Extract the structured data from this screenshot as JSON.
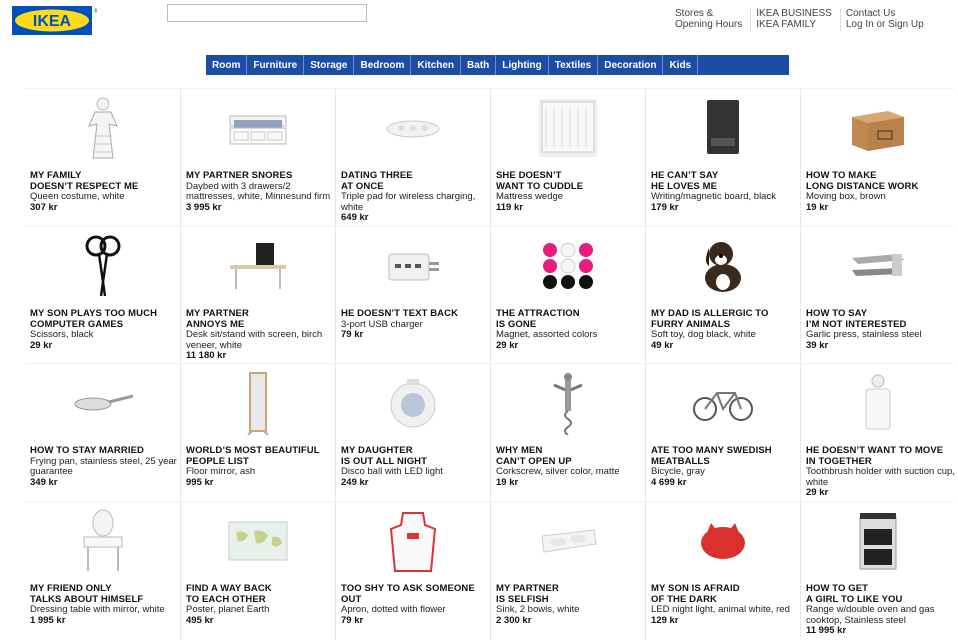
{
  "brand": {
    "logo_text": "IKEA",
    "registered": "®",
    "blue": "#0051ba",
    "yellow": "#ffda1a"
  },
  "search": {
    "placeholder": "",
    "value": ""
  },
  "top_links": [
    [
      "Stores &",
      "Opening Hours"
    ],
    [
      "IKEA BUSINESS",
      "IKEA FAMILY"
    ],
    [
      "Contact Us",
      "Log In or Sign Up"
    ]
  ],
  "nav": [
    "Room",
    "Furniture",
    "Storage",
    "Bedroom",
    "Kitchen",
    "Bath",
    "Lighting",
    "Textiles",
    "Decoration",
    "Kids"
  ],
  "products": [
    {
      "title": "My family\ndoesn’t respect me",
      "desc": "Queen costume, white",
      "price": "307 kr",
      "icon": "costume-icon"
    },
    {
      "title": "My partner snores",
      "desc": "Daybed with 3 drawers/2 mattresses, white, Minnesund firm",
      "price": "3 995 kr",
      "icon": "daybed-icon"
    },
    {
      "title": "Dating three\nat once",
      "desc": "Triple pad for wireless charging, white",
      "price": "649 kr",
      "icon": "charging-pad-icon"
    },
    {
      "title": "She doesn’t\nwant to cuddle",
      "desc": "Mattress wedge",
      "price": "119 kr",
      "icon": "mattress-wedge-icon"
    },
    {
      "title": "He can’t say\nhe loves me",
      "desc": "Writing/magnetic board, black",
      "price": "179 kr",
      "icon": "board-icon"
    },
    {
      "title": "How to make\nlong distance work",
      "desc": "Moving box, brown",
      "price": "19 kr",
      "icon": "moving-box-icon"
    },
    {
      "title": "My son plays too much\ncomputer games",
      "desc": "Scissors, black",
      "price": "29 kr",
      "icon": "scissors-icon"
    },
    {
      "title": "My partner\nannoys me",
      "desc": "Desk sit/stand with screen, birch veneer, white",
      "price": "11 180 kr",
      "icon": "desk-icon"
    },
    {
      "title": "He doesn’t text back",
      "desc": "3-port USB charger",
      "price": "79 kr",
      "icon": "usb-charger-icon"
    },
    {
      "title": "The attraction\nis gone",
      "desc": "Magnet, assorted colors",
      "price": "29 kr",
      "icon": "magnets-icon"
    },
    {
      "title": "My dad is allergic to\nfurry animals",
      "desc": "Soft toy, dog black, white",
      "price": "49 kr",
      "icon": "soft-toy-dog-icon"
    },
    {
      "title": "How to say\nI’m not interested",
      "desc": "Garlic press, stainless steel",
      "price": "39 kr",
      "icon": "garlic-press-icon"
    },
    {
      "title": "How to stay married",
      "desc": "Frying pan, stainless steel, 25 year guarantee",
      "price": "349 kr",
      "icon": "frying-pan-icon"
    },
    {
      "title": "World’s most beautiful\npeople list",
      "desc": "Floor mirror, ash",
      "price": "995 kr",
      "icon": "floor-mirror-icon"
    },
    {
      "title": "My daughter\nis out all night",
      "desc": "Disco ball with LED light",
      "price": "249 kr",
      "icon": "disco-ball-icon"
    },
    {
      "title": "Why men\ncan’t open up",
      "desc": "Corkscrew, silver color, matte",
      "price": "19 kr",
      "icon": "corkscrew-icon"
    },
    {
      "title": "Ate too many Swedish\nmeatballs",
      "desc": "Bicycle, gray",
      "price": "4 699 kr",
      "icon": "bicycle-icon"
    },
    {
      "title": "He doesn’t want to move\nin together",
      "desc": "Toothbrush holder with suction cup, white",
      "price": "29 kr",
      "icon": "toothbrush-holder-icon"
    },
    {
      "title": "My friend only\ntalks about himself",
      "desc": "Dressing table with mirror, white",
      "price": "1 995 kr",
      "icon": "dressing-table-icon"
    },
    {
      "title": "Find a way back\nto each other",
      "desc": "Poster, planet Earth",
      "price": "495 kr",
      "icon": "world-map-poster-icon"
    },
    {
      "title": "Too shy to ask someone\nout",
      "desc": "Apron, dotted with flower",
      "price": "79 kr",
      "icon": "apron-icon"
    },
    {
      "title": "My partner\nis selfish",
      "desc": "Sink, 2 bowls, white",
      "price": "2 300 kr",
      "icon": "sink-icon"
    },
    {
      "title": "My son is afraid\nof the dark",
      "desc": "LED night light, animal white, red",
      "price": "129 kr",
      "icon": "night-light-icon"
    },
    {
      "title": "How to get\na girl to like you",
      "desc": "Range w/double oven and gas cooktop, Stainless steel",
      "price": "11 995 kr",
      "icon": "range-oven-icon"
    }
  ]
}
